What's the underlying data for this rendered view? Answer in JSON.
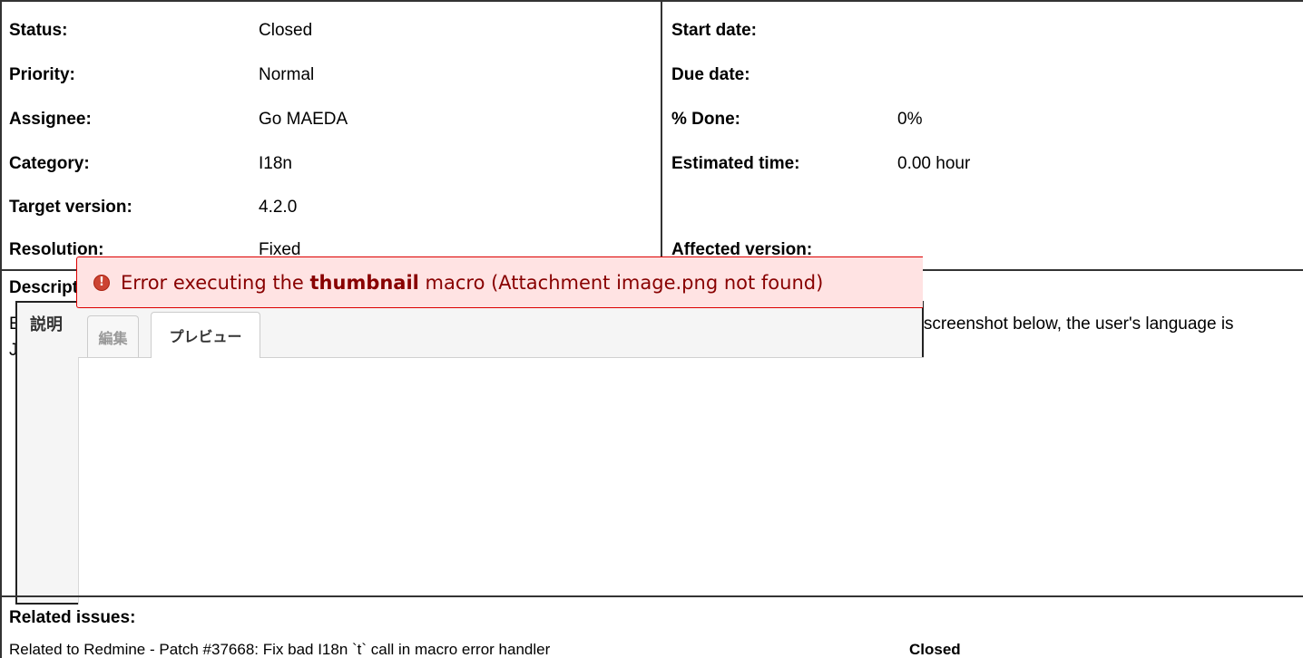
{
  "attributes": {
    "left": [
      {
        "label": "Status:",
        "value": "Closed"
      },
      {
        "label": "Priority:",
        "value": "Normal"
      },
      {
        "label": "Assignee:",
        "value": "Go MAEDA"
      },
      {
        "label": "Category:",
        "value": "I18n"
      },
      {
        "label": "Target version:",
        "value": "4.2.0"
      },
      {
        "label": "Resolution:",
        "value": "Fixed"
      }
    ],
    "right": [
      {
        "label": "Start date:",
        "value": ""
      },
      {
        "label": "Due date:",
        "value": ""
      },
      {
        "label": "% Done:",
        "value": "0%"
      },
      {
        "label": "Estimated time:",
        "value": "0.00 hour"
      },
      {
        "label": "",
        "value": ""
      },
      {
        "label": "Affected version:",
        "value": ""
      }
    ]
  },
  "description": {
    "heading": "Description",
    "text": "Error messages of Wiki macros are always displayed in English regardless of the current user's language setting. In the screenshot below, the user's language is Japanese.",
    "screenshot": {
      "label": "説明",
      "tab_edit": "編集",
      "tab_preview": "プレビュー",
      "error_prefix": "Error executing the ",
      "error_macro": "thumbnail",
      "error_suffix": " macro (Attachment image.png not found)",
      "error_icon": "!"
    }
  },
  "related": {
    "heading": "Related issues:",
    "items": [
      {
        "text": "Related to Redmine - Patch #37668: Fix bad I18n `t` call in macro error handler",
        "status": "Closed"
      }
    ]
  }
}
